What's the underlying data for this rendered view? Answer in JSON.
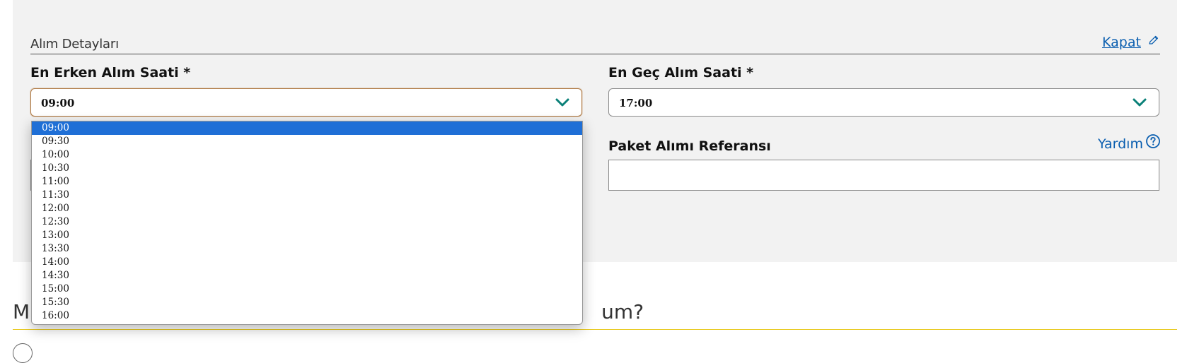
{
  "section": {
    "title": "Alım Detayları",
    "close_link": "Kapat"
  },
  "earliest": {
    "label": "En Erken Alım Saati *",
    "value": "09:00"
  },
  "latest": {
    "label": "En Geç Alım Saati *",
    "value": "17:00"
  },
  "reference": {
    "label": "Paket Alımı Referansı",
    "help_link": "Yardım",
    "value": ""
  },
  "dropdown": {
    "options": [
      "09:00",
      "09:30",
      "10:00",
      "10:30",
      "11:00",
      "11:30",
      "12:00",
      "12:30",
      "13:00",
      "13:30",
      "14:00",
      "14:30",
      "15:00",
      "15:30",
      "16:00"
    ],
    "selected": "09:00"
  },
  "question": {
    "prefix": "M",
    "suffix": "um?"
  },
  "colors": {
    "accent": "#0b5fb0",
    "chevron": "#0a8078",
    "selected_option": "#1f6fd6",
    "yellow_rule": "#e8c81a"
  },
  "icons": {
    "close": "pencil-icon",
    "dropdown": "chevron-down-icon",
    "help": "question-circle-icon"
  }
}
